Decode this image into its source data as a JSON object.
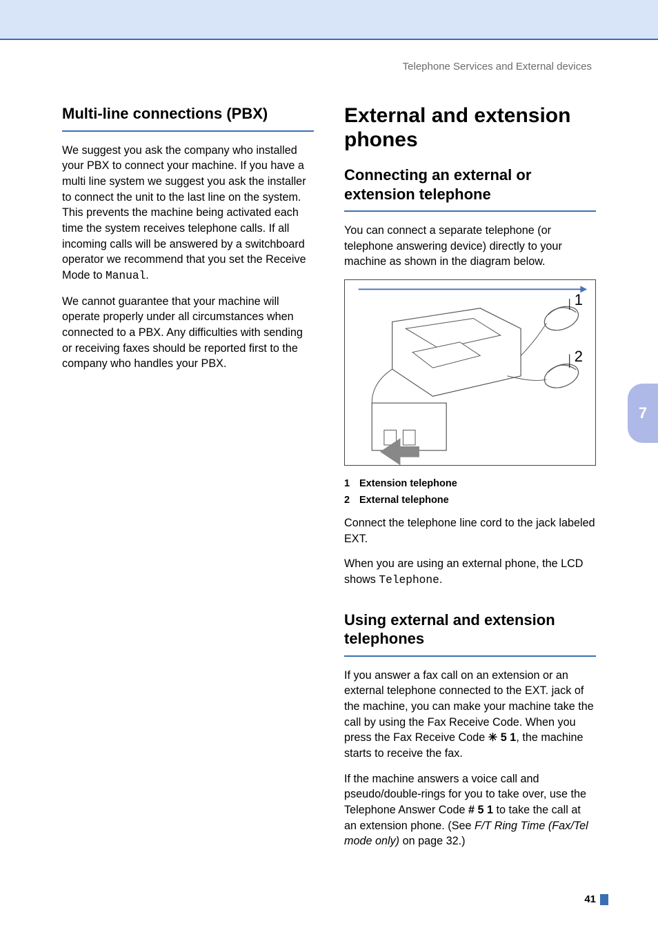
{
  "header": {
    "running_head": "Telephone Services and External devices"
  },
  "tab": {
    "chapter_number": "7"
  },
  "footer": {
    "page_number": "41"
  },
  "left": {
    "h2": "Multi-line connections (PBX)",
    "p1_a": "We suggest you ask the company who installed your PBX to connect your machine. If you have a multi line system we suggest you ask the installer to connect the unit to the last line on the system. This prevents the machine being activated each time the system receives telephone calls. If all incoming calls will be answered by a switchboard operator we recommend that you set the Receive Mode to ",
    "p1_mono": "Manual",
    "p1_b": ".",
    "p2": "We cannot guarantee that your machine will operate properly under all circumstances when connected to a PBX. Any difficulties with sending or receiving faxes should be reported first to the company who handles your PBX."
  },
  "right": {
    "h1": "External and extension phones",
    "sec1": {
      "h2": "Connecting an external or extension telephone",
      "p1": "You can connect a separate telephone (or telephone answering device) directly to your machine as shown in the diagram below.",
      "diagram": {
        "label1": "1",
        "label2": "2"
      },
      "legend1_num": "1",
      "legend1_text": "Extension telephone",
      "legend2_num": "2",
      "legend2_text": "External telephone",
      "p2": "Connect the telephone line cord to the jack labeled EXT.",
      "p3_a": "When you are using an external phone, the LCD shows ",
      "p3_mono": "Telephone",
      "p3_b": "."
    },
    "sec2": {
      "h2": "Using external and extension telephones",
      "p1_a": "If you answer a fax call on an extension or an external telephone connected to the EXT. jack of the machine, you can make your machine take the call by using the Fax Receive Code. When you press the Fax Receive Code ",
      "p1_code": "✳ 5 1",
      "p1_b": ", the machine starts to receive the fax.",
      "p2_a": "If the machine answers a voice call and pseudo/double-rings for you to take over, use the Telephone Answer Code ",
      "p2_code": "# 5 1",
      "p2_b": " to take the call at an extension phone. (See ",
      "p2_ref": "F/T Ring Time (Fax/Tel mode only)",
      "p2_c": " on page 32.)"
    }
  }
}
